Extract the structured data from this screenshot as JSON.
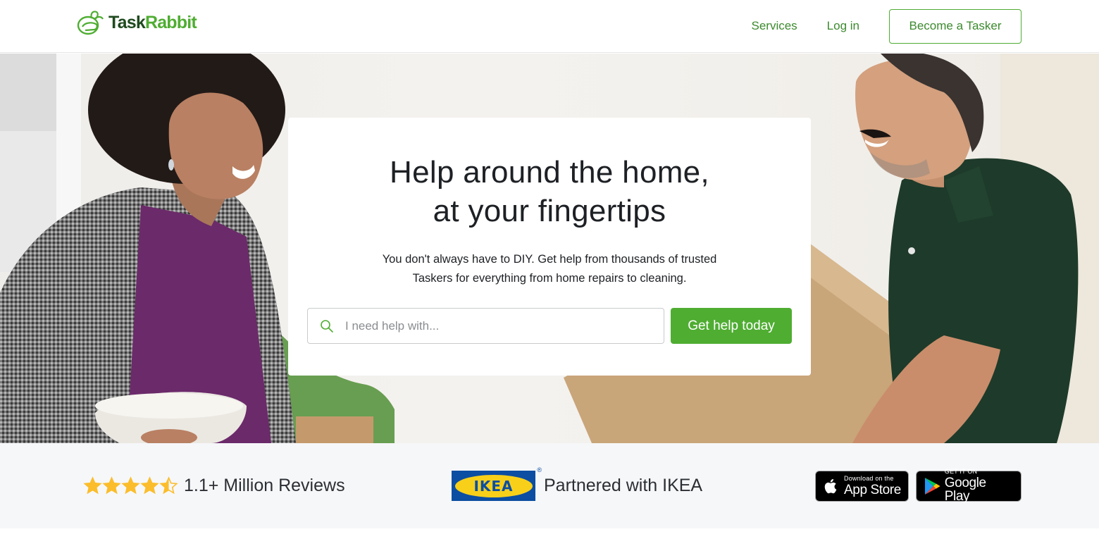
{
  "brand": {
    "name_part1": "Task",
    "name_part2": "Rabbit",
    "colors": {
      "green": "#4fad32",
      "dark_green": "#1f4a1f",
      "link_green": "#3c8a2e",
      "text": "#1d2024",
      "trust_bg": "#f6f7f9",
      "star": "#fbbd2b"
    }
  },
  "nav": {
    "services": "Services",
    "login": "Log in",
    "become_tasker": "Become a Tasker"
  },
  "hero": {
    "headline_line1": "Help around the home,",
    "headline_line2": "at your fingertips",
    "subtext_line1": "You don't always have to DIY. Get help from thousands of trusted",
    "subtext_line2": "Taskers for everything from home repairs to cleaning.",
    "search": {
      "placeholder": "I need help with...",
      "value": "",
      "icon": "search-icon"
    },
    "cta_label": "Get help today"
  },
  "trust": {
    "rating": 4.5,
    "rating_max": 5,
    "reviews_text": "1.1+ Million Reviews",
    "ikea_logo_text": "IKEA",
    "ikea_reg": "®",
    "partner_text": "Partnered with IKEA",
    "app_store": {
      "small": "Download on the",
      "big": "App Store",
      "icon": "apple-icon"
    },
    "google_play": {
      "small": "GET IT ON",
      "big": "Google Play",
      "icon": "google-play-icon"
    }
  }
}
